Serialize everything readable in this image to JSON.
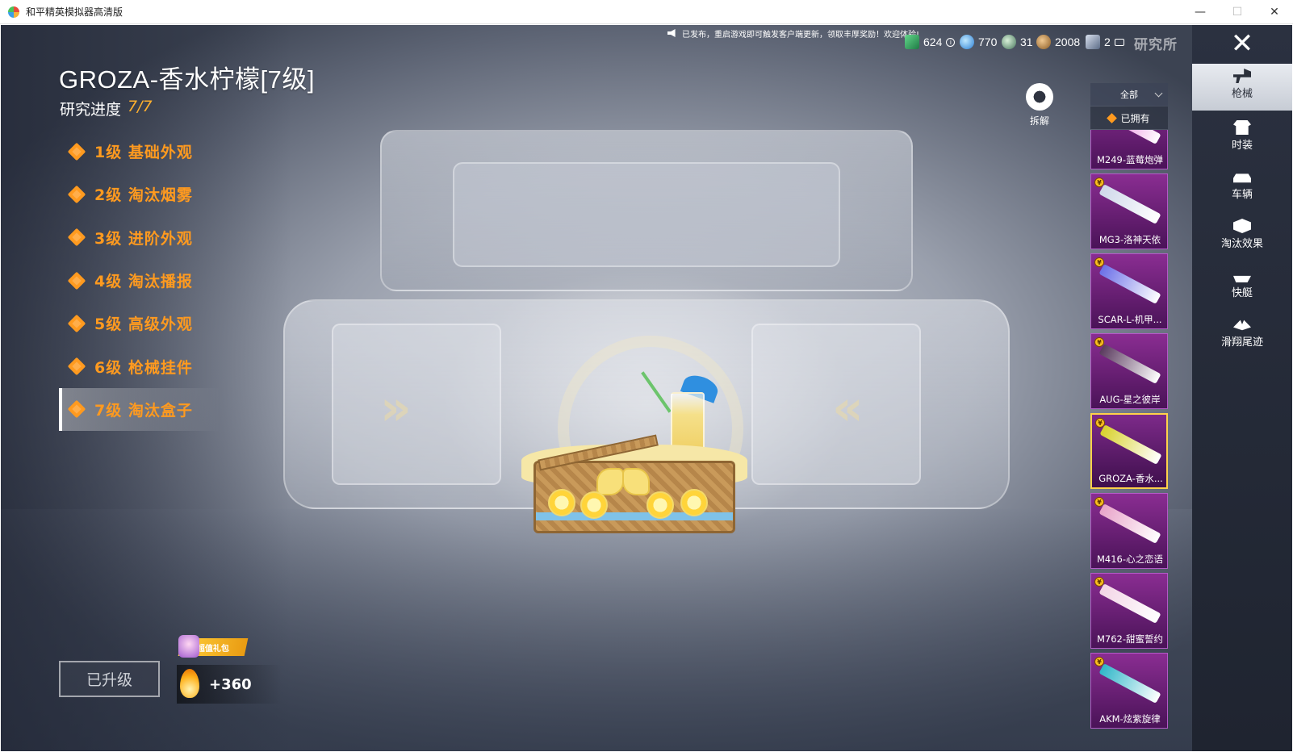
{
  "window": {
    "title": "和平精英模拟器高清版",
    "controls": {
      "minimize": "—",
      "maximize": "☐",
      "close": "✕"
    }
  },
  "header": {
    "item_title": "GROZA-香水柠檬[7级]",
    "progress_label": "研究进度",
    "progress_value": "7/7"
  },
  "levels": [
    {
      "label": "1级 基础外观"
    },
    {
      "label": "2级 淘汰烟雾"
    },
    {
      "label": "3级 进阶外观"
    },
    {
      "label": "4级 淘汰播报"
    },
    {
      "label": "5级 高级外观"
    },
    {
      "label": "6级 枪械挂件"
    },
    {
      "label": "7级 淘汰盒子",
      "active": true
    }
  ],
  "footer": {
    "upgrade_button": "已升级",
    "gift_tag": "超值礼包",
    "fire_value": "+360"
  },
  "topbar": {
    "notice": "已发布，重启游戏即可触发客户端更新，领取丰厚奖励！欢迎体验!",
    "currencies": [
      {
        "icon": "jade-ticket-icon",
        "value": "624"
      },
      {
        "icon": "globe-coin-icon",
        "value": "770"
      },
      {
        "icon": "medal-icon",
        "value": "31"
      },
      {
        "icon": "bronze-coin-icon",
        "value": "2008"
      },
      {
        "icon": "card-ticket-icon",
        "value": "2"
      }
    ],
    "lab_label": "研究所"
  },
  "actions": {
    "dismantle": "拆解",
    "filter_selected": "全部",
    "owned_label": "已拥有"
  },
  "guns": [
    {
      "name": "M249-蓝莓炮弹",
      "color": "#e35bd2"
    },
    {
      "name": "MG3-洛神天依",
      "color": "#cfd8ea"
    },
    {
      "name": "SCAR-L-机甲...",
      "color": "#6b6fe8"
    },
    {
      "name": "AUG-星之彼岸",
      "color": "#5a3a5e"
    },
    {
      "name": "GROZA-香水...",
      "color": "#d8d12c",
      "selected": true
    },
    {
      "name": "M416-心之恋语",
      "color": "#e8a3c9"
    },
    {
      "name": "M762-甜蜜誓约",
      "color": "#f3d5e6"
    },
    {
      "name": "AKM-炫紫旋律",
      "color": "#2fb6c8"
    }
  ],
  "nav": [
    {
      "label": "枪械",
      "active": true
    },
    {
      "label": "时装"
    },
    {
      "label": "车辆"
    },
    {
      "label": "淘汰效果"
    },
    {
      "label": "快艇"
    },
    {
      "label": "滑翔尾迹"
    }
  ]
}
